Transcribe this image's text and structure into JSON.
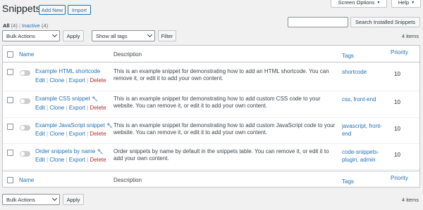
{
  "header": {
    "title": "Snippets",
    "add_new": "Add New",
    "import": "Import",
    "screen_options": "Screen Options",
    "help": "Help"
  },
  "filters": {
    "all_label": "All",
    "all_count": "(4)",
    "separator": "|",
    "inactive_label": "Inactive",
    "inactive_count": "(4)"
  },
  "search": {
    "value": "",
    "button": "Search Installed Snippets"
  },
  "top_nav": {
    "bulk_actions": "Bulk Actions",
    "apply": "Apply",
    "tags_filter": "Show all tags",
    "filter": "Filter",
    "items": "4 items"
  },
  "columns": {
    "name": "Name",
    "description": "Description",
    "tags": "Tags",
    "priority": "Priority"
  },
  "row_actions": {
    "edit": "Edit",
    "clone": "Clone",
    "export": "Export",
    "delete": "Delete",
    "sep": "|"
  },
  "snippets": [
    {
      "name": "Example HTML shortcode",
      "description": "This is an example snippet for demonstrating how to add an HTML shortcode. You can remove it, or edit it to add your own content.",
      "tags": [
        "shortcode"
      ],
      "priority": "10",
      "active": false,
      "icon": ""
    },
    {
      "name": "Example CSS snippet",
      "description": "This is an example snippet for demonstrating how to add custom CSS code to your website. You can remove it, or edit it to add your own content.",
      "tags": [
        "css, ",
        "front-end"
      ],
      "priority": "10",
      "active": false,
      "icon": "wrench-icon"
    },
    {
      "name": "Example JavaScript snippet",
      "description": "This is an example snippet for demonstrating how to add custom JavaScript code to your website. You can remove it, or edit it to add your own content.",
      "tags": [
        "javascript, front-",
        "end"
      ],
      "priority": "10",
      "active": false,
      "icon": "wrench-icon"
    },
    {
      "name": "Order snippets by name",
      "description": "Order snippets by name by default in the snippets table. You can remove it, or edit it to add your own content.",
      "tags": [
        "code-snippets-",
        "plugin, admin"
      ],
      "priority": "10",
      "active": false,
      "icon": "wrench-icon"
    }
  ],
  "bottom_nav": {
    "bulk_actions": "Bulk Actions",
    "apply": "Apply",
    "items": "4 items"
  }
}
